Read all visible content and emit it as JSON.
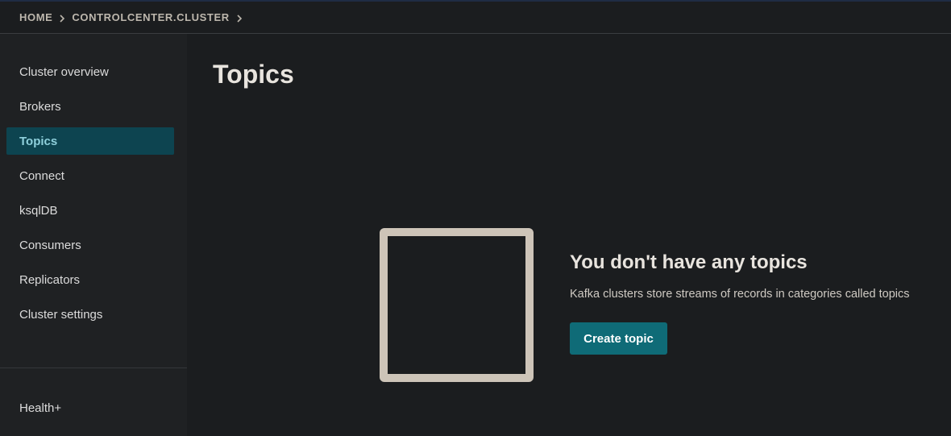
{
  "header": {
    "breadcrumb": [
      {
        "label": "HOME"
      },
      {
        "label": "CONTROLCENTER.CLUSTER"
      }
    ]
  },
  "sidebar": {
    "items": [
      {
        "label": "Cluster overview",
        "active": false
      },
      {
        "label": "Brokers",
        "active": false
      },
      {
        "label": "Topics",
        "active": true
      },
      {
        "label": "Connect",
        "active": false
      },
      {
        "label": "ksqlDB",
        "active": false
      },
      {
        "label": "Consumers",
        "active": false
      },
      {
        "label": "Replicators",
        "active": false
      },
      {
        "label": "Cluster settings",
        "active": false
      }
    ],
    "footer_item": {
      "label": "Health+"
    }
  },
  "main": {
    "title": "Topics",
    "empty_state": {
      "title": "You don't have any topics",
      "description": "Kafka clusters store streams of records in categories called topics",
      "button_label": "Create topic"
    }
  },
  "colors": {
    "active_nav_bg": "#0d4450",
    "active_nav_text": "#8fd0dc",
    "primary_button": "#0f6b77",
    "empty_frame": "#cdc4b8"
  },
  "icons": {
    "breadcrumb_separator": "chevron-right-icon"
  }
}
